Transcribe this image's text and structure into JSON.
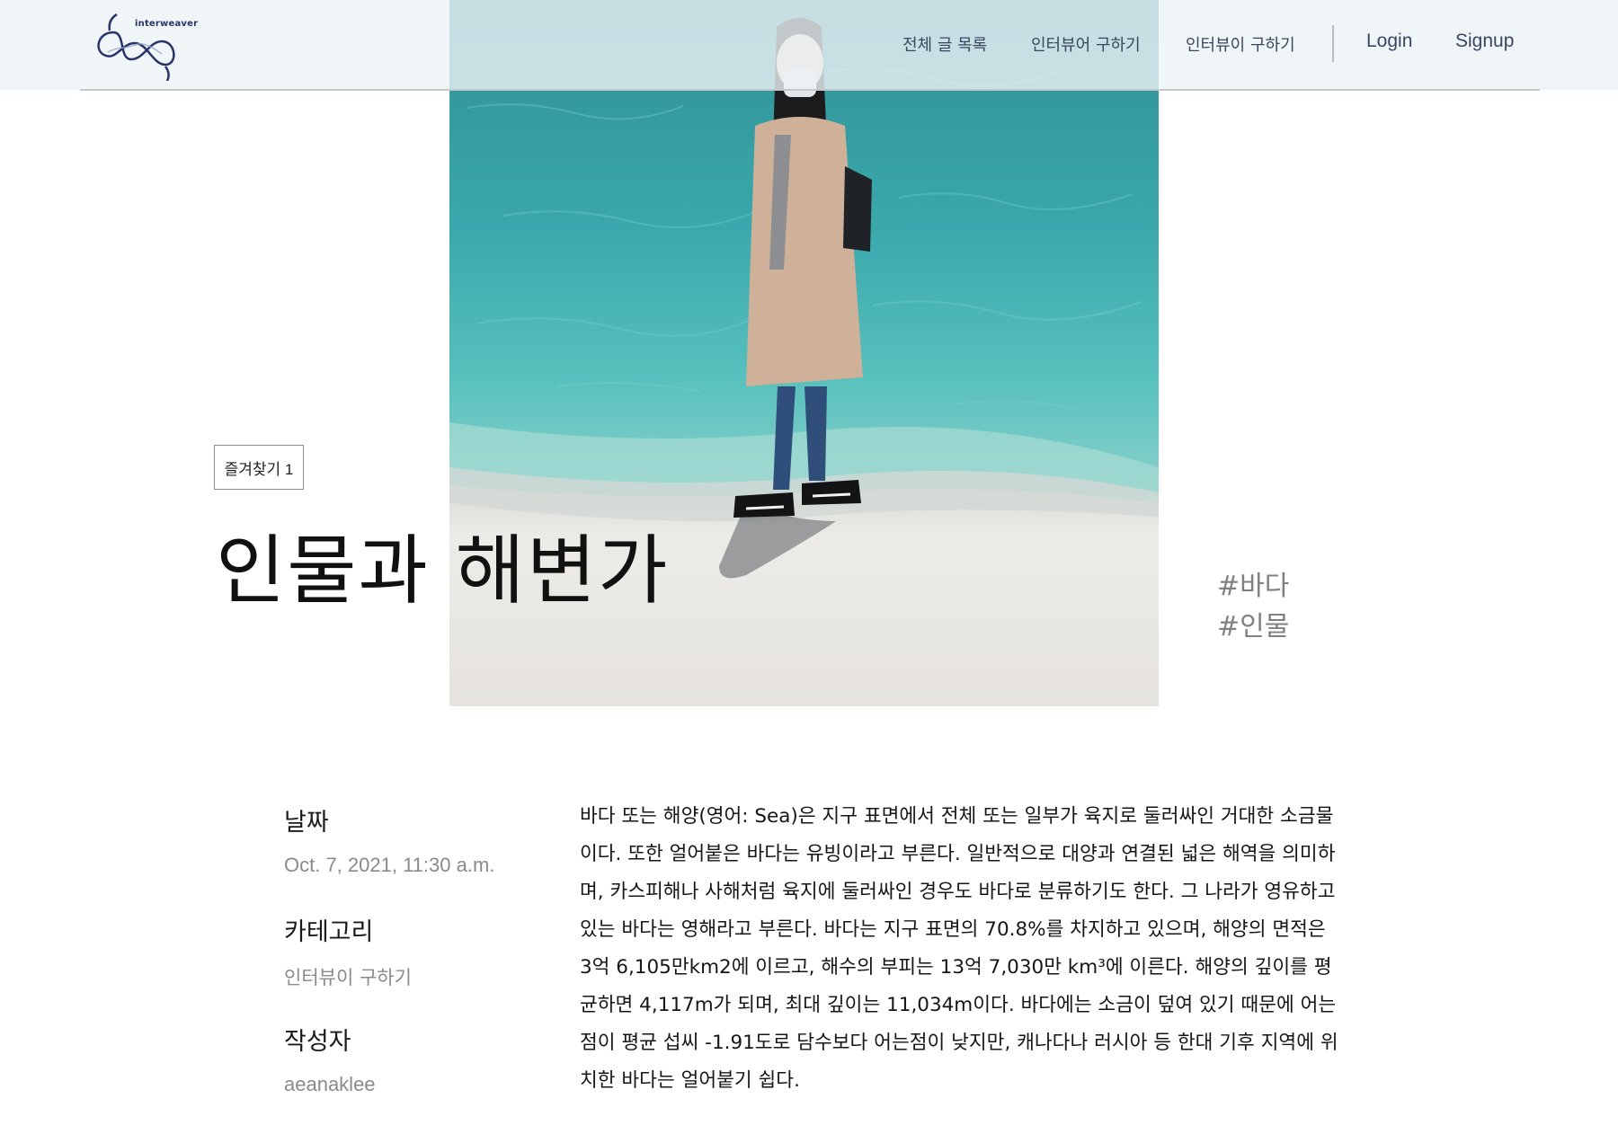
{
  "header": {
    "logo_text": "interweaver",
    "nav": [
      {
        "label": "전체 글 목록"
      },
      {
        "label": "인터뷰어 구하기"
      },
      {
        "label": "인터뷰이 구하기"
      }
    ],
    "login_label": "Login",
    "signup_label": "Signup"
  },
  "post": {
    "bookmark_label": "즐겨찾기 1",
    "title": "인물과 해변가",
    "tags": [
      "#바다",
      "#인물"
    ],
    "meta": {
      "date_label": "날짜",
      "date_value": "Oct. 7, 2021, 11:30 a.m.",
      "category_label": "카테고리",
      "category_value": "인터뷰이 구하기",
      "author_label": "작성자",
      "author_value": "aeanaklee"
    },
    "content": "바다 또는 해양(영어: Sea)은 지구 표면에서 전체 또는 일부가 육지로 둘러싸인 거대한 소금물이다. 또한 얼어붙은 바다는 유빙이라고 부른다. 일반적으로 대양과 연결된 넓은 해역을 의미하며, 카스피해나 사해처럼 육지에 둘러싸인 경우도 바다로 분류하기도 한다. 그 나라가 영유하고 있는 바다는 영해라고 부른다. 바다는 지구 표면의 70.8%를 차지하고 있으며, 해양의 면적은 3억 6,105만km2에 이르고, 해수의 부피는 13억 7,030만 km³에 이른다. 해양의 깊이를 평균하면 4,117m가 되며, 최대 깊이는 11,034m이다. 바다에는 소금이 덮여 있기 때문에 어는점이 평균 섭씨 -1.91도로 담수보다 어는점이 낮지만, 캐나다나 러시아 등 한대 기후 지역에 위치한 바다는 얼어붙기 쉽다."
  },
  "colors": {
    "header_bg": "#ecf2f6",
    "nav_text": "#3a4560",
    "sea": "#3aa8ac",
    "sand": "#eae8e4",
    "tag_text": "#808080",
    "meta_value_text": "#8a8a8a"
  }
}
